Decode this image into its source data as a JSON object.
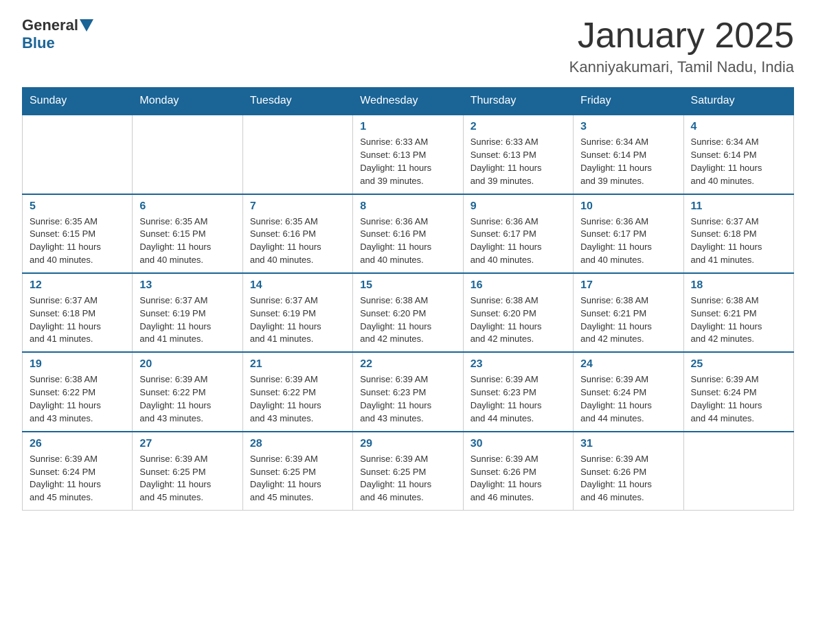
{
  "header": {
    "logo": {
      "general": "General",
      "blue": "Blue"
    },
    "title": "January 2025",
    "location": "Kanniyakumari, Tamil Nadu, India"
  },
  "calendar": {
    "weekdays": [
      "Sunday",
      "Monday",
      "Tuesday",
      "Wednesday",
      "Thursday",
      "Friday",
      "Saturday"
    ],
    "weeks": [
      [
        {
          "day": "",
          "info": ""
        },
        {
          "day": "",
          "info": ""
        },
        {
          "day": "",
          "info": ""
        },
        {
          "day": "1",
          "info": "Sunrise: 6:33 AM\nSunset: 6:13 PM\nDaylight: 11 hours\nand 39 minutes."
        },
        {
          "day": "2",
          "info": "Sunrise: 6:33 AM\nSunset: 6:13 PM\nDaylight: 11 hours\nand 39 minutes."
        },
        {
          "day": "3",
          "info": "Sunrise: 6:34 AM\nSunset: 6:14 PM\nDaylight: 11 hours\nand 39 minutes."
        },
        {
          "day": "4",
          "info": "Sunrise: 6:34 AM\nSunset: 6:14 PM\nDaylight: 11 hours\nand 40 minutes."
        }
      ],
      [
        {
          "day": "5",
          "info": "Sunrise: 6:35 AM\nSunset: 6:15 PM\nDaylight: 11 hours\nand 40 minutes."
        },
        {
          "day": "6",
          "info": "Sunrise: 6:35 AM\nSunset: 6:15 PM\nDaylight: 11 hours\nand 40 minutes."
        },
        {
          "day": "7",
          "info": "Sunrise: 6:35 AM\nSunset: 6:16 PM\nDaylight: 11 hours\nand 40 minutes."
        },
        {
          "day": "8",
          "info": "Sunrise: 6:36 AM\nSunset: 6:16 PM\nDaylight: 11 hours\nand 40 minutes."
        },
        {
          "day": "9",
          "info": "Sunrise: 6:36 AM\nSunset: 6:17 PM\nDaylight: 11 hours\nand 40 minutes."
        },
        {
          "day": "10",
          "info": "Sunrise: 6:36 AM\nSunset: 6:17 PM\nDaylight: 11 hours\nand 40 minutes."
        },
        {
          "day": "11",
          "info": "Sunrise: 6:37 AM\nSunset: 6:18 PM\nDaylight: 11 hours\nand 41 minutes."
        }
      ],
      [
        {
          "day": "12",
          "info": "Sunrise: 6:37 AM\nSunset: 6:18 PM\nDaylight: 11 hours\nand 41 minutes."
        },
        {
          "day": "13",
          "info": "Sunrise: 6:37 AM\nSunset: 6:19 PM\nDaylight: 11 hours\nand 41 minutes."
        },
        {
          "day": "14",
          "info": "Sunrise: 6:37 AM\nSunset: 6:19 PM\nDaylight: 11 hours\nand 41 minutes."
        },
        {
          "day": "15",
          "info": "Sunrise: 6:38 AM\nSunset: 6:20 PM\nDaylight: 11 hours\nand 42 minutes."
        },
        {
          "day": "16",
          "info": "Sunrise: 6:38 AM\nSunset: 6:20 PM\nDaylight: 11 hours\nand 42 minutes."
        },
        {
          "day": "17",
          "info": "Sunrise: 6:38 AM\nSunset: 6:21 PM\nDaylight: 11 hours\nand 42 minutes."
        },
        {
          "day": "18",
          "info": "Sunrise: 6:38 AM\nSunset: 6:21 PM\nDaylight: 11 hours\nand 42 minutes."
        }
      ],
      [
        {
          "day": "19",
          "info": "Sunrise: 6:38 AM\nSunset: 6:22 PM\nDaylight: 11 hours\nand 43 minutes."
        },
        {
          "day": "20",
          "info": "Sunrise: 6:39 AM\nSunset: 6:22 PM\nDaylight: 11 hours\nand 43 minutes."
        },
        {
          "day": "21",
          "info": "Sunrise: 6:39 AM\nSunset: 6:22 PM\nDaylight: 11 hours\nand 43 minutes."
        },
        {
          "day": "22",
          "info": "Sunrise: 6:39 AM\nSunset: 6:23 PM\nDaylight: 11 hours\nand 43 minutes."
        },
        {
          "day": "23",
          "info": "Sunrise: 6:39 AM\nSunset: 6:23 PM\nDaylight: 11 hours\nand 44 minutes."
        },
        {
          "day": "24",
          "info": "Sunrise: 6:39 AM\nSunset: 6:24 PM\nDaylight: 11 hours\nand 44 minutes."
        },
        {
          "day": "25",
          "info": "Sunrise: 6:39 AM\nSunset: 6:24 PM\nDaylight: 11 hours\nand 44 minutes."
        }
      ],
      [
        {
          "day": "26",
          "info": "Sunrise: 6:39 AM\nSunset: 6:24 PM\nDaylight: 11 hours\nand 45 minutes."
        },
        {
          "day": "27",
          "info": "Sunrise: 6:39 AM\nSunset: 6:25 PM\nDaylight: 11 hours\nand 45 minutes."
        },
        {
          "day": "28",
          "info": "Sunrise: 6:39 AM\nSunset: 6:25 PM\nDaylight: 11 hours\nand 45 minutes."
        },
        {
          "day": "29",
          "info": "Sunrise: 6:39 AM\nSunset: 6:25 PM\nDaylight: 11 hours\nand 46 minutes."
        },
        {
          "day": "30",
          "info": "Sunrise: 6:39 AM\nSunset: 6:26 PM\nDaylight: 11 hours\nand 46 minutes."
        },
        {
          "day": "31",
          "info": "Sunrise: 6:39 AM\nSunset: 6:26 PM\nDaylight: 11 hours\nand 46 minutes."
        },
        {
          "day": "",
          "info": ""
        }
      ]
    ]
  }
}
